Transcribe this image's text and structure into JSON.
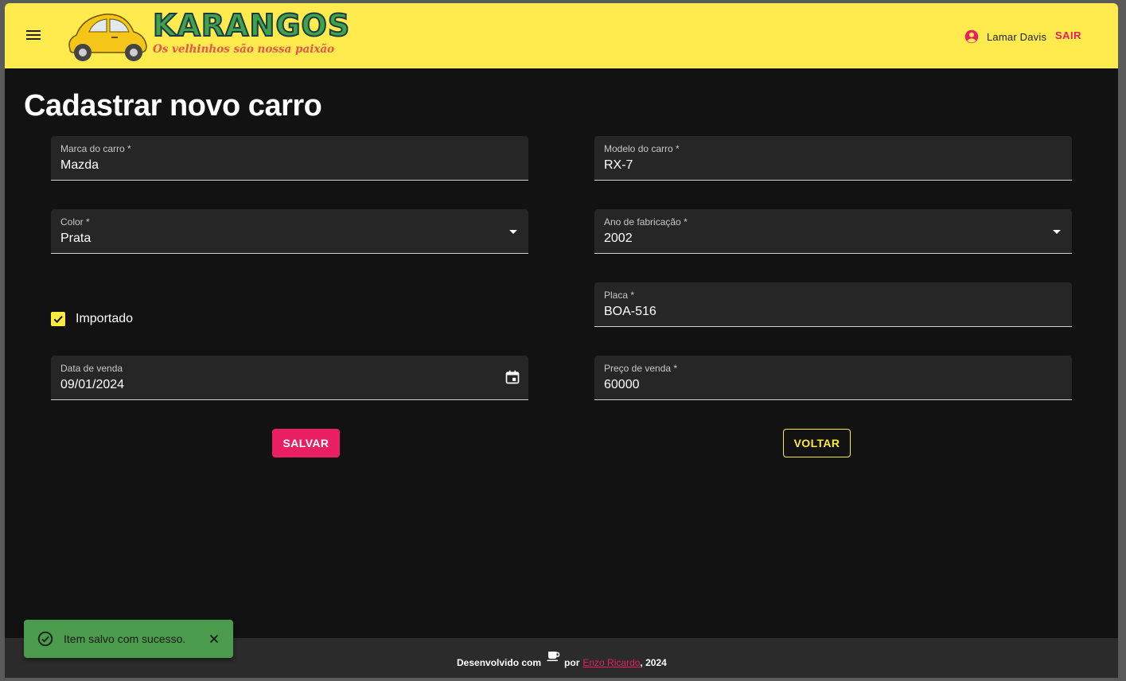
{
  "header": {
    "brand_title": "KARANGOS",
    "brand_subtitle": "Os velhinhos são nossa paixão",
    "user_name": "Lamar Davis",
    "logout_label": "SAIR"
  },
  "page": {
    "title": "Cadastrar novo carro"
  },
  "form": {
    "brand": {
      "label": "Marca do carro *",
      "value": "Mazda"
    },
    "model": {
      "label": "Modelo do carro *",
      "value": "RX-7"
    },
    "color": {
      "label": "Color *",
      "value": "Prata"
    },
    "year": {
      "label": "Ano de fabricação *",
      "value": "2002"
    },
    "imported": {
      "label": "Importado",
      "checked": true
    },
    "plate": {
      "label": "Placa *",
      "value": "BOA-516"
    },
    "sale_date": {
      "label": "Data de venda",
      "value": "09/01/2024"
    },
    "price": {
      "label": "Preço de venda *",
      "value": "60000"
    },
    "save_label": "SALVAR",
    "back_label": "VOLTAR"
  },
  "footer": {
    "prefix": "Desenvolvido com",
    "by": "por",
    "author": "Enzo Ricardo",
    "suffix": ", 2024"
  },
  "snackbar": {
    "message": "Item salvo com sucesso."
  },
  "colors": {
    "appbar": "#ffeb4d",
    "primary": "#e91e63",
    "secondary": "#ffeb3b",
    "background": "#121212",
    "success": "#4a9b4c"
  },
  "icons": [
    "menu-icon",
    "car-logo",
    "account-circle-icon",
    "arrow-drop-down-icon",
    "calendar-icon",
    "check-icon",
    "coffee-icon",
    "check-circle-icon",
    "close-icon"
  ]
}
